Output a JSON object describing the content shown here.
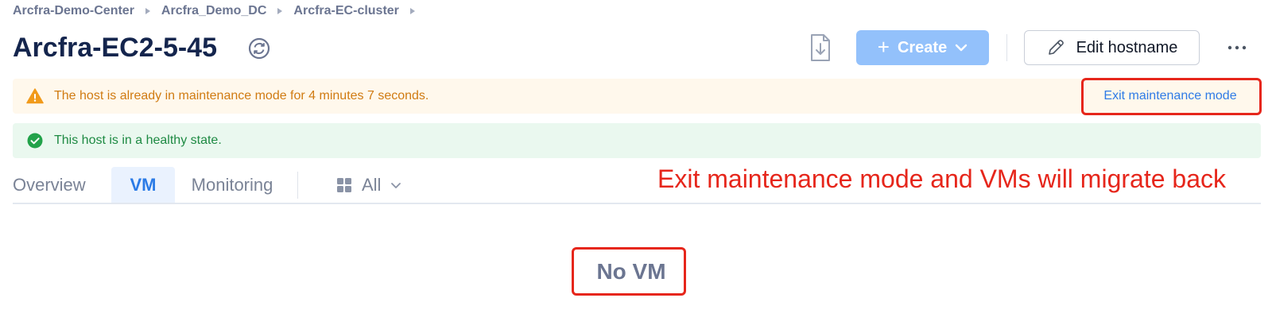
{
  "breadcrumb": [
    "Arcfra-Demo-Center",
    "Arcfra_Demo_DC",
    "Arcfra-EC-cluster"
  ],
  "title": "Arcfra-EC2-5-45",
  "toolbar": {
    "create_label": "Create",
    "edit_label": "Edit hostname",
    "more_label": "···"
  },
  "alerts": {
    "maintenance": "The host is already in maintenance mode for 4 minutes 7 seconds.",
    "exit_label": "Exit maintenance mode",
    "healthy": "This host is in a healthy state."
  },
  "tabs": [
    "Overview",
    "VM",
    "Monitoring"
  ],
  "active_tab": "VM",
  "filter_label": "All",
  "annotation": "Exit maintenance mode and VMs will migrate back",
  "empty_text": "No VM",
  "colors": {
    "accent": "#2b7be6",
    "create_button": "#93c1fb",
    "warning_bg": "#fff8ec",
    "warning_text": "#d07b12",
    "success_bg": "#eaf8ef",
    "success_text": "#1e8a43",
    "annotation_red": "#e6261b"
  }
}
